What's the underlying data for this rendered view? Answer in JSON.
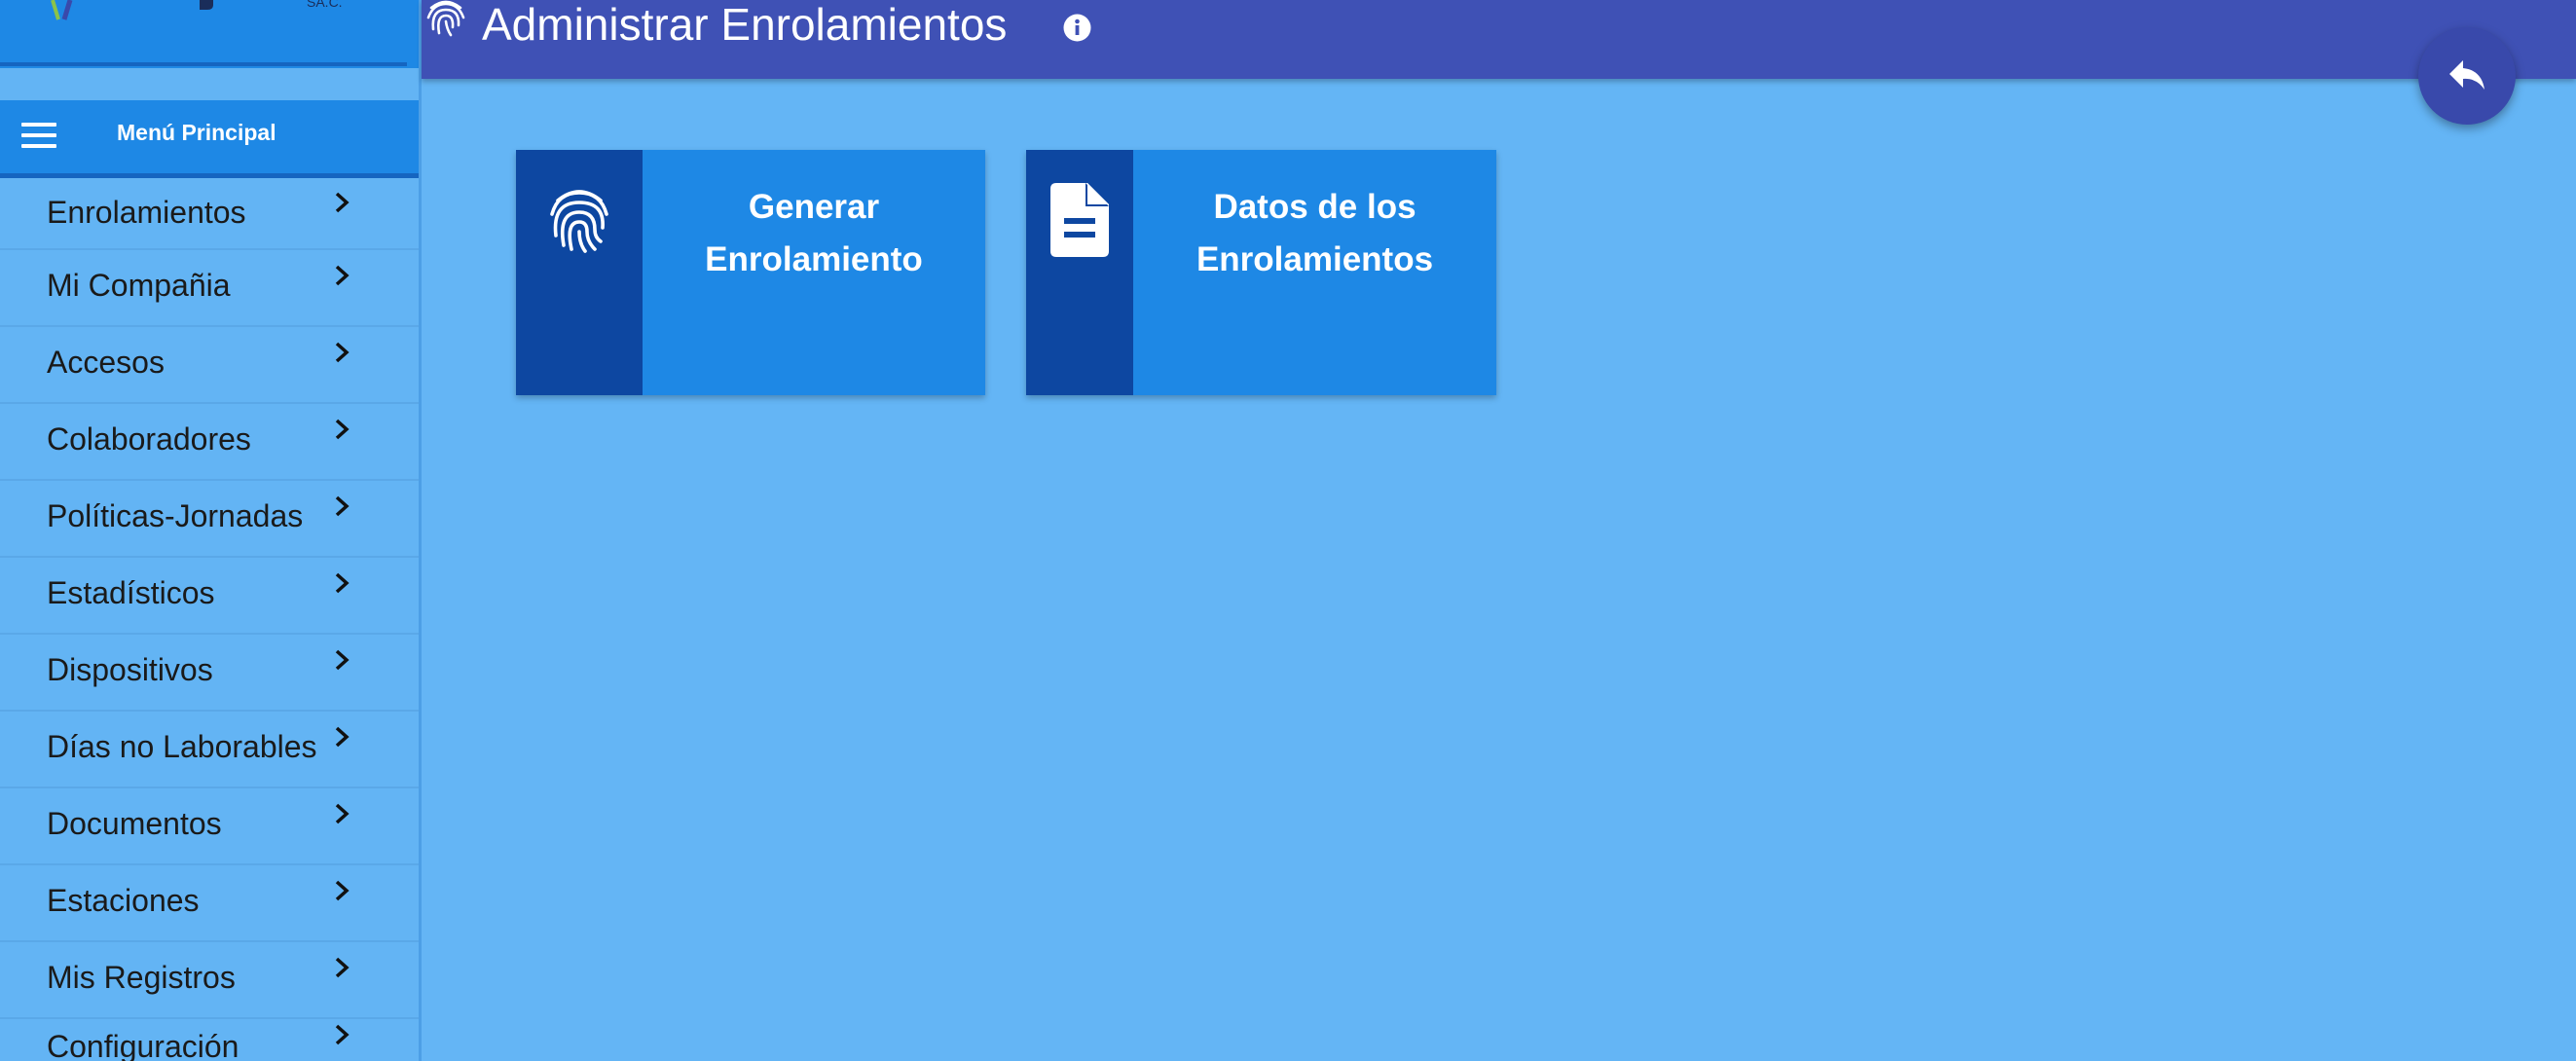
{
  "colors": {
    "background": "#64b5f5",
    "topbar": "#3f51b5",
    "menu_header": "#1e88e5",
    "card": "#1e88e5",
    "card_strip": "#0d47a1",
    "fab": "#3949ab"
  },
  "header": {
    "title": "Administrar Enrolamientos",
    "title_icon": "fingerprint-icon",
    "info_icon": "info-icon"
  },
  "fab": {
    "icon": "reply-icon"
  },
  "sidebar": {
    "logo_small_text": "SA.C.",
    "menu_title": "Menú Principal",
    "menu_icon": "hamburger-menu-icon",
    "items": [
      {
        "label": "Enrolamientos"
      },
      {
        "label": "Mi Compañia"
      },
      {
        "label": "Accesos"
      },
      {
        "label": "Colaboradores"
      },
      {
        "label": "Políticas-Jornadas"
      },
      {
        "label": "Estadísticos"
      },
      {
        "label": "Dispositivos"
      },
      {
        "label": "Días no Laborables"
      },
      {
        "label": "Documentos"
      },
      {
        "label": "Estaciones"
      },
      {
        "label": "Mis Registros"
      },
      {
        "label": "Configuración"
      }
    ]
  },
  "cards": [
    {
      "line1": "Generar",
      "line2": "Enrolamiento",
      "icon": "fingerprint-icon"
    },
    {
      "line1": "Datos de los",
      "line2": "Enrolamientos",
      "icon": "document-icon"
    }
  ]
}
